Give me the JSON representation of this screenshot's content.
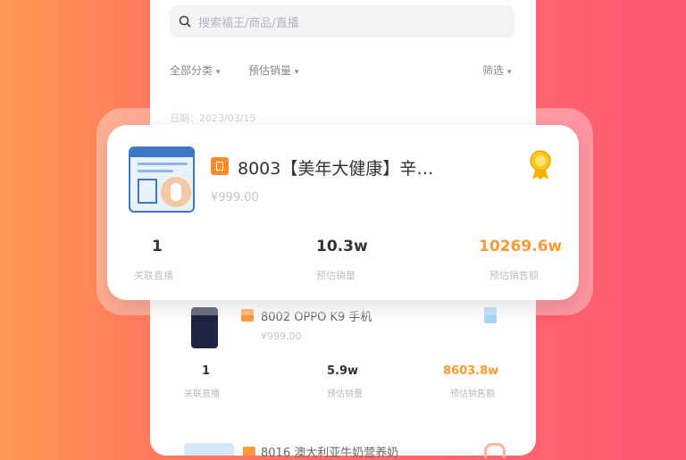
{
  "search": {
    "placeholder": "搜索福王/商品/直播"
  },
  "filters": {
    "category": "全部分类",
    "sort": "预估销量",
    "screen": "筛选"
  },
  "stat_time": "日期：2023/03/15",
  "featured": {
    "title": "8003【美年大健康】辛…",
    "price": "¥999.00",
    "stats": [
      {
        "value": "1",
        "label": "关联直播"
      },
      {
        "value": "10.3w",
        "label": "预估销量"
      },
      {
        "value": "10269.6w",
        "label": "预估销售额"
      }
    ]
  },
  "second": {
    "title": "8002 OPPO K9 手机",
    "price": "¥999.00",
    "stats": [
      {
        "value": "1",
        "label": "关联直播"
      },
      {
        "value": "5.9w",
        "label": "预估销量"
      },
      {
        "value": "8603.8w",
        "label": "预估销售额"
      }
    ]
  },
  "third": {
    "title": "8016 澳大利亚牛奶营养奶"
  },
  "colors": {
    "accent": "#ff8a2b",
    "highlight_value": "#ff9a2e"
  },
  "icons": [
    "search-icon",
    "chevron-down-icon",
    "rank-badge-icon",
    "gold-medal-icon",
    "silver-medal-icon",
    "bronze-medal-icon"
  ]
}
